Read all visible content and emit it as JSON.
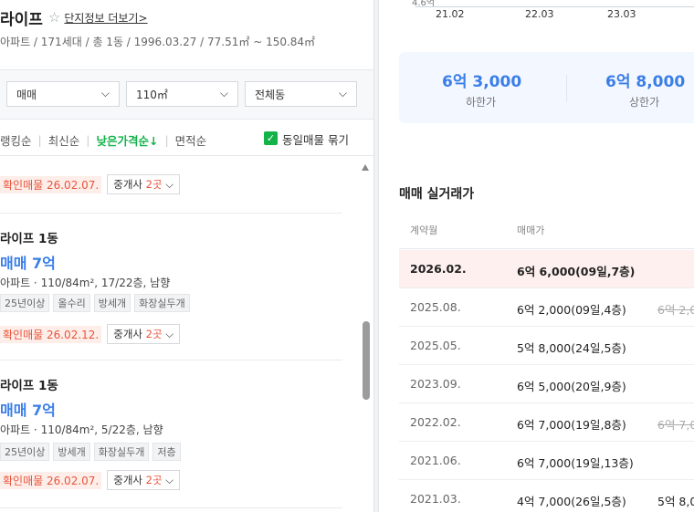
{
  "complex": {
    "name": "라이프",
    "more_link": "단지정보 더보기>",
    "info": "아파트 / 171세대 / 총 1동 / 1996.03.27 / 77.51㎡ ~ 150.84㎡"
  },
  "filters": [
    {
      "value": "매매"
    },
    {
      "value": "110㎡"
    },
    {
      "value": "전체동"
    }
  ],
  "sort": {
    "items": [
      "랭킹순",
      "최신순",
      "낮은가격순↓",
      "면적순"
    ],
    "active_index": 2,
    "checkbox_label": "동일매물 묶기",
    "checkbox_checked": true
  },
  "listings": [
    {
      "confirm": "확인매물 26.02.07.",
      "broker_prefix": "중개사 ",
      "broker_count": "2곳"
    },
    {
      "name": "라이프 1동",
      "price": "매매 7억",
      "info": "아파트 · 110/84m², 17/22층, 남향",
      "tags": [
        "25년이상",
        "올수리",
        "방세개",
        "화장실두개"
      ],
      "confirm": "확인매물 26.02.12.",
      "broker_prefix": "중개사 ",
      "broker_count": "2곳"
    },
    {
      "name": "라이프 1동",
      "price": "매매 7억",
      "info": "아파트 · 110/84m², 5/22층, 남향",
      "tags": [
        "25년이상",
        "방세개",
        "화장실두개",
        "저층"
      ],
      "confirm": "확인매물 26.02.07.",
      "broker_prefix": "중개사 ",
      "broker_count": "2곳"
    }
  ],
  "chart": {
    "y_label_partial": "4.6억",
    "x_ticks": [
      "21.02",
      "22.03",
      "23.03"
    ]
  },
  "price_range": {
    "low_value": "6억 3,000",
    "low_label": "하한가",
    "high_value": "6억 8,000",
    "high_label": "상한가"
  },
  "trades": {
    "title": "매매 실거래가",
    "col_month": "계약월",
    "col_price": "매매가",
    "rows": [
      {
        "month": "2026.02.",
        "price": "6억 6,000(09일,7층)",
        "extra": ""
      },
      {
        "month": "2025.08.",
        "price": "6억 2,000(09일,4층)",
        "extra": "6억 2,0"
      },
      {
        "month": "2025.05.",
        "price": "5억 8,000(24일,5층)",
        "extra": ""
      },
      {
        "month": "2023.09.",
        "price": "6억 5,000(20일,9층)",
        "extra": ""
      },
      {
        "month": "2022.02.",
        "price": "6억 7,000(19일,8층)",
        "extra": "6억 7,0"
      },
      {
        "month": "2021.06.",
        "price": "6억 7,000(19일,13층)",
        "extra": ""
      },
      {
        "month": "2021.03.",
        "price": "4억 7,000(26일,5층)",
        "extra": "5억 8,0"
      }
    ]
  },
  "colors": {
    "accent_green": "#13b34a",
    "price_blue": "#3a7ee8",
    "confirm_red": "#e8543b"
  }
}
